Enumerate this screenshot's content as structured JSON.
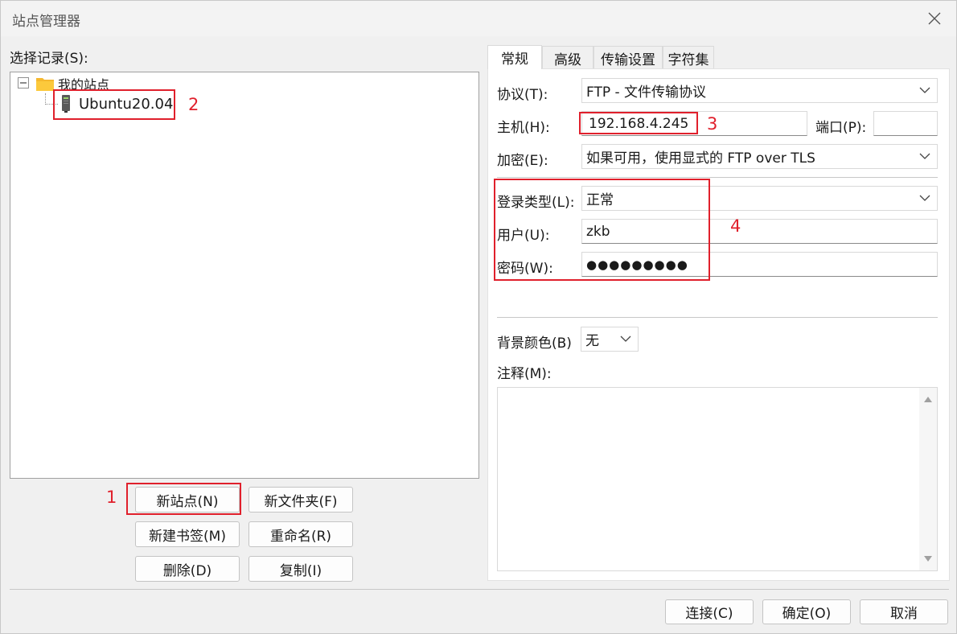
{
  "window": {
    "title": "站点管理器"
  },
  "left": {
    "select_label": "选择记录(S):",
    "tree": {
      "root_label": "我的站点",
      "child_label": "Ubuntu20.04"
    },
    "buttons": {
      "new_site": "新站点(N)",
      "new_folder": "新文件夹(F)",
      "new_bookmark": "新建书签(M)",
      "rename": "重命名(R)",
      "delete": "删除(D)",
      "copy": "复制(I)"
    }
  },
  "tabs": [
    "常规",
    "高级",
    "传输设置",
    "字符集"
  ],
  "general": {
    "protocol_label": "协议(T):",
    "protocol_value": "FTP - 文件传输协议",
    "host_label": "主机(H):",
    "host_value": "192.168.4.245",
    "port_label": "端口(P):",
    "port_value": "",
    "encryption_label": "加密(E):",
    "encryption_value": "如果可用，使用显式的 FTP over TLS",
    "logon_type_label": "登录类型(L):",
    "logon_type_value": "正常",
    "user_label": "用户(U):",
    "user_value": "zkb",
    "password_label": "密码(W):",
    "password_value": "●●●●●●●●●",
    "bg_color_label": "背景颜色(B)",
    "bg_color_value": "无",
    "notes_label": "注释(M):",
    "notes_value": ""
  },
  "annotations": [
    "1",
    "2",
    "3",
    "4"
  ],
  "footer": {
    "connect": "连接(C)",
    "ok": "确定(O)",
    "cancel": "取消"
  },
  "colors": {
    "highlight_red": "#e0202c",
    "folder": "#f5b82e"
  },
  "icons": [
    "close-icon",
    "folder-icon",
    "server-icon",
    "chevron-down-icon",
    "collapse-icon"
  ]
}
